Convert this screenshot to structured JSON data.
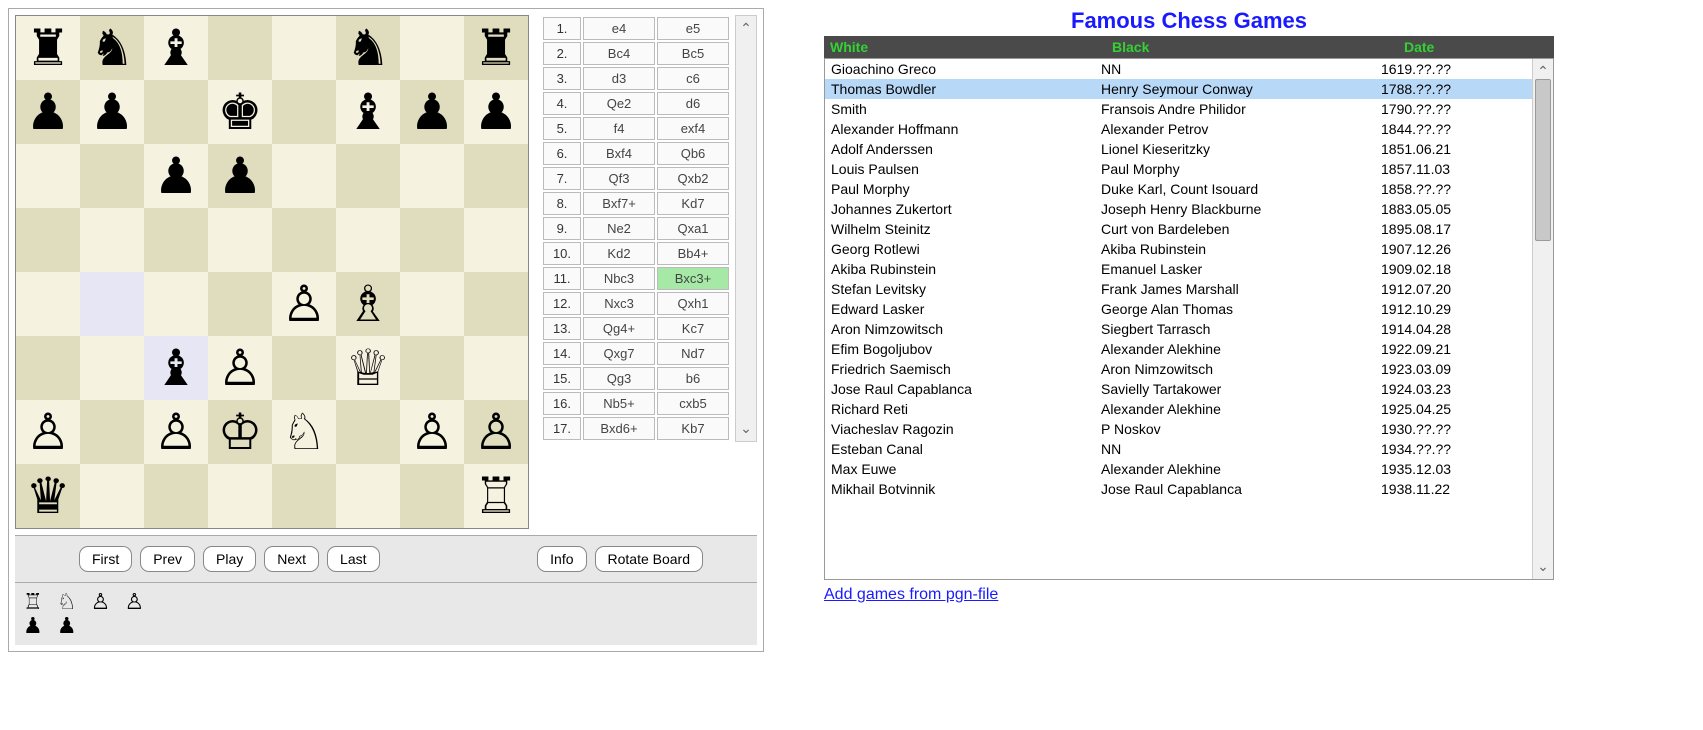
{
  "board": {
    "squares": [
      [
        "♜",
        "♞",
        "♝",
        "",
        "",
        "♞",
        "",
        "♜"
      ],
      [
        "♟",
        "♟",
        "",
        "♚",
        "",
        "♝",
        "♟",
        "♟"
      ],
      [
        "",
        "",
        "♟",
        "♟",
        "",
        "",
        "",
        ""
      ],
      [
        "",
        "",
        "",
        "",
        "",
        "",
        "",
        ""
      ],
      [
        "",
        "",
        "",
        "",
        "♙",
        "♗",
        "",
        ""
      ],
      [
        "",
        "",
        "♝",
        "♙",
        "",
        "♕",
        "",
        ""
      ],
      [
        "♙",
        "",
        "♙",
        "♔",
        "♘",
        "",
        "♙",
        "♙"
      ],
      [
        "♛",
        "",
        "",
        "",
        "",
        "",
        "",
        "♖"
      ]
    ],
    "highlights": [
      [
        4,
        1
      ],
      [
        5,
        2
      ]
    ]
  },
  "moves": [
    {
      "n": "1.",
      "w": "e4",
      "b": "e5"
    },
    {
      "n": "2.",
      "w": "Bc4",
      "b": "Bc5"
    },
    {
      "n": "3.",
      "w": "d3",
      "b": "c6"
    },
    {
      "n": "4.",
      "w": "Qe2",
      "b": "d6"
    },
    {
      "n": "5.",
      "w": "f4",
      "b": "exf4"
    },
    {
      "n": "6.",
      "w": "Bxf4",
      "b": "Qb6"
    },
    {
      "n": "7.",
      "w": "Qf3",
      "b": "Qxb2"
    },
    {
      "n": "8.",
      "w": "Bxf7+",
      "b": "Kd7"
    },
    {
      "n": "9.",
      "w": "Ne2",
      "b": "Qxa1"
    },
    {
      "n": "10.",
      "w": "Kd2",
      "b": "Bb4+"
    },
    {
      "n": "11.",
      "w": "Nbc3",
      "b": "Bxc3+"
    },
    {
      "n": "12.",
      "w": "Nxc3",
      "b": "Qxh1"
    },
    {
      "n": "13.",
      "w": "Qg4+",
      "b": "Kc7"
    },
    {
      "n": "14.",
      "w": "Qxg7",
      "b": "Nd7"
    },
    {
      "n": "15.",
      "w": "Qg3",
      "b": "b6"
    },
    {
      "n": "16.",
      "w": "Nb5+",
      "b": "cxb5"
    },
    {
      "n": "17.",
      "w": "Bxd6+",
      "b": "Kb7"
    }
  ],
  "current_move_index": 10,
  "current_move_side": "b",
  "controls": {
    "first": "First",
    "prev": "Prev",
    "play": "Play",
    "next": "Next",
    "last": "Last",
    "info": "Info",
    "rotate": "Rotate Board"
  },
  "captured": {
    "white": "♖ ♘ ♙ ♙",
    "black": "♟ ♟"
  },
  "games_title": "Famous Chess Games",
  "games_header": {
    "white": "White",
    "black": "Black",
    "date": "Date"
  },
  "games_selected_index": 1,
  "games": [
    {
      "w": "Gioachino Greco",
      "b": "NN",
      "d": "1619.??.??"
    },
    {
      "w": "Thomas Bowdler",
      "b": "Henry Seymour Conway",
      "d": "1788.??.??"
    },
    {
      "w": "Smith",
      "b": "Fransois Andre Philidor",
      "d": "1790.??.??"
    },
    {
      "w": "Alexander Hoffmann",
      "b": "Alexander Petrov",
      "d": "1844.??.??"
    },
    {
      "w": "Adolf Anderssen",
      "b": "Lionel Kieseritzky",
      "d": "1851.06.21"
    },
    {
      "w": "Louis Paulsen",
      "b": "Paul Morphy",
      "d": "1857.11.03"
    },
    {
      "w": "Paul Morphy",
      "b": "Duke Karl, Count Isouard",
      "d": "1858.??.??"
    },
    {
      "w": "Johannes Zukertort",
      "b": "Joseph Henry Blackburne",
      "d": "1883.05.05"
    },
    {
      "w": "Wilhelm Steinitz",
      "b": "Curt von Bardeleben",
      "d": "1895.08.17"
    },
    {
      "w": "Georg Rotlewi",
      "b": "Akiba Rubinstein",
      "d": "1907.12.26"
    },
    {
      "w": "Akiba Rubinstein",
      "b": "Emanuel Lasker",
      "d": "1909.02.18"
    },
    {
      "w": "Stefan Levitsky",
      "b": "Frank James Marshall",
      "d": "1912.07.20"
    },
    {
      "w": "Edward Lasker",
      "b": "George Alan Thomas",
      "d": "1912.10.29"
    },
    {
      "w": "Aron Nimzowitsch",
      "b": "Siegbert Tarrasch",
      "d": "1914.04.28"
    },
    {
      "w": "Efim Bogoljubov",
      "b": "Alexander Alekhine",
      "d": "1922.09.21"
    },
    {
      "w": "Friedrich Saemisch",
      "b": "Aron Nimzowitsch",
      "d": "1923.03.09"
    },
    {
      "w": "Jose Raul Capablanca",
      "b": "Savielly Tartakower",
      "d": "1924.03.23"
    },
    {
      "w": "Richard Reti",
      "b": "Alexander Alekhine",
      "d": "1925.04.25"
    },
    {
      "w": "Viacheslav Ragozin",
      "b": "P Noskov",
      "d": "1930.??.??"
    },
    {
      "w": "Esteban Canal",
      "b": "NN",
      "d": "1934.??.??"
    },
    {
      "w": "Max Euwe",
      "b": "Alexander Alekhine",
      "d": "1935.12.03"
    },
    {
      "w": "Mikhail Botvinnik",
      "b": "Jose Raul Capablanca",
      "d": "1938.11.22"
    }
  ],
  "add_link": "Add games from pgn-file"
}
